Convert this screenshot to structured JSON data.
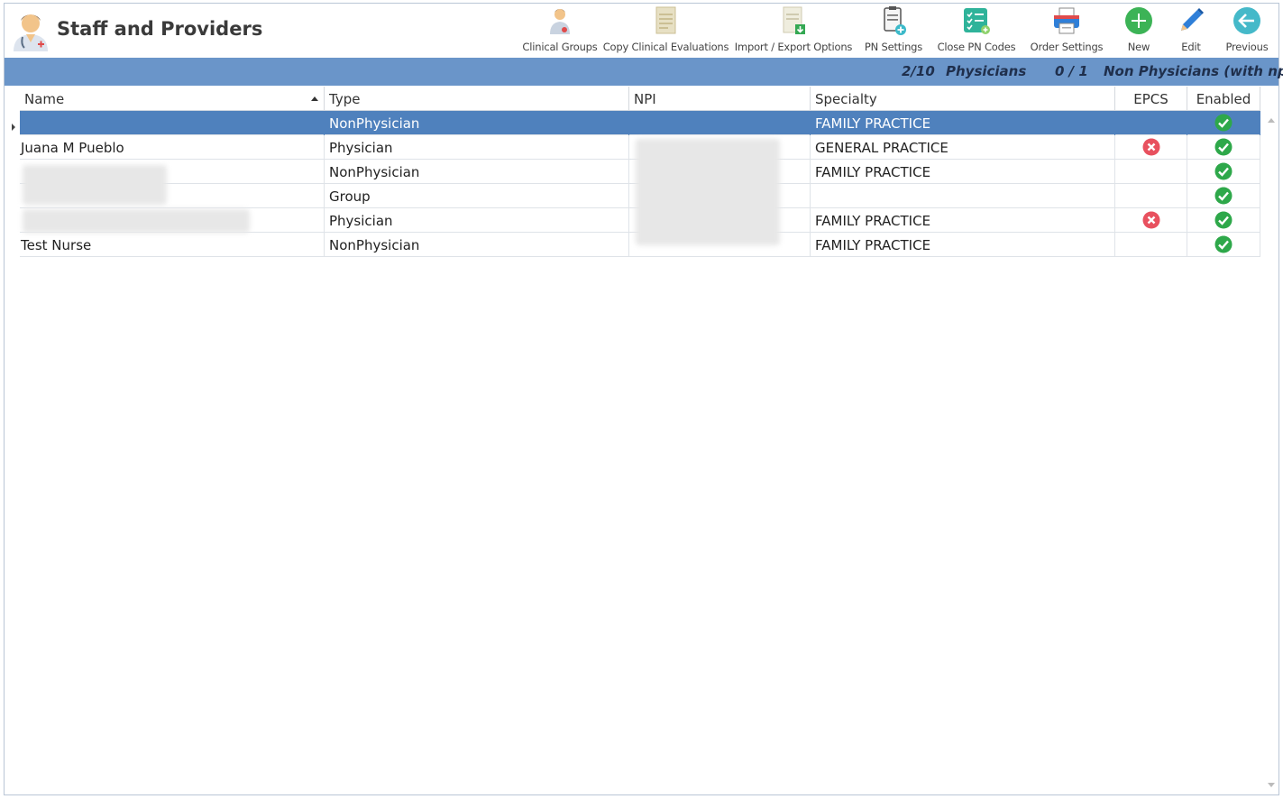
{
  "app": {
    "title": "Staff and Providers",
    "logo_icon": "staff-doctor-icon"
  },
  "toolbar": [
    {
      "label": "Clinical Groups",
      "icon": "clinical-groups-icon"
    },
    {
      "label": "Copy Clinical Evaluations",
      "icon": "copy-document-icon"
    },
    {
      "label": "Import / Export Options",
      "icon": "import-export-icon"
    },
    {
      "label": "PN Settings",
      "icon": "pn-settings-icon"
    },
    {
      "label": "Close PN Codes",
      "icon": "close-pn-codes-icon"
    },
    {
      "label": "Order Settings",
      "icon": "printer-icon"
    },
    {
      "label": "New",
      "icon": "plus-circle-icon"
    },
    {
      "label": "Edit",
      "icon": "pencil-icon"
    },
    {
      "label": "Previous",
      "icon": "back-arrow-icon"
    }
  ],
  "summary": {
    "physicians_count": "2/10",
    "physicians_label": "Physicians",
    "nonphysicians_count": "0 / 1",
    "nonphysicians_label": "Non Physicians (with npi)"
  },
  "grid": {
    "columns": [
      "Name",
      "Type",
      "NPI",
      "Specialty",
      "EPCS",
      "Enabled"
    ],
    "sort_column": "Name",
    "sort_direction": "ascending",
    "rows": [
      {
        "name": "",
        "type": "NonPhysician",
        "npi": "",
        "specialty": "FAMILY PRACTICE",
        "epcs": "none",
        "enabled": "yes",
        "selected": true
      },
      {
        "name": "Juana M Pueblo",
        "type": "Physician",
        "npi": "",
        "specialty": "GENERAL PRACTICE",
        "epcs": "no",
        "enabled": "yes",
        "selected": false
      },
      {
        "name": "",
        "type": "NonPhysician",
        "npi": "",
        "specialty": "FAMILY PRACTICE",
        "epcs": "none",
        "enabled": "yes",
        "selected": false
      },
      {
        "name": "",
        "type": "Group",
        "npi": "",
        "specialty": "",
        "epcs": "none",
        "enabled": "yes",
        "selected": false
      },
      {
        "name": "",
        "type": "Physician",
        "npi": "",
        "specialty": "FAMILY PRACTICE",
        "epcs": "no",
        "enabled": "yes",
        "selected": false
      },
      {
        "name": "Test Nurse",
        "type": "NonPhysician",
        "npi": "",
        "specialty": "FAMILY PRACTICE",
        "epcs": "none",
        "enabled": "yes",
        "selected": false
      }
    ]
  },
  "colors": {
    "summary_bar": "#6a95c9",
    "selected_row": "#4f81bd",
    "check_green": "#2ea84a",
    "cross_red": "#e8515f",
    "new_green": "#3cb356",
    "edit_blue": "#2f7fd8",
    "previous_teal": "#45b9c9"
  }
}
